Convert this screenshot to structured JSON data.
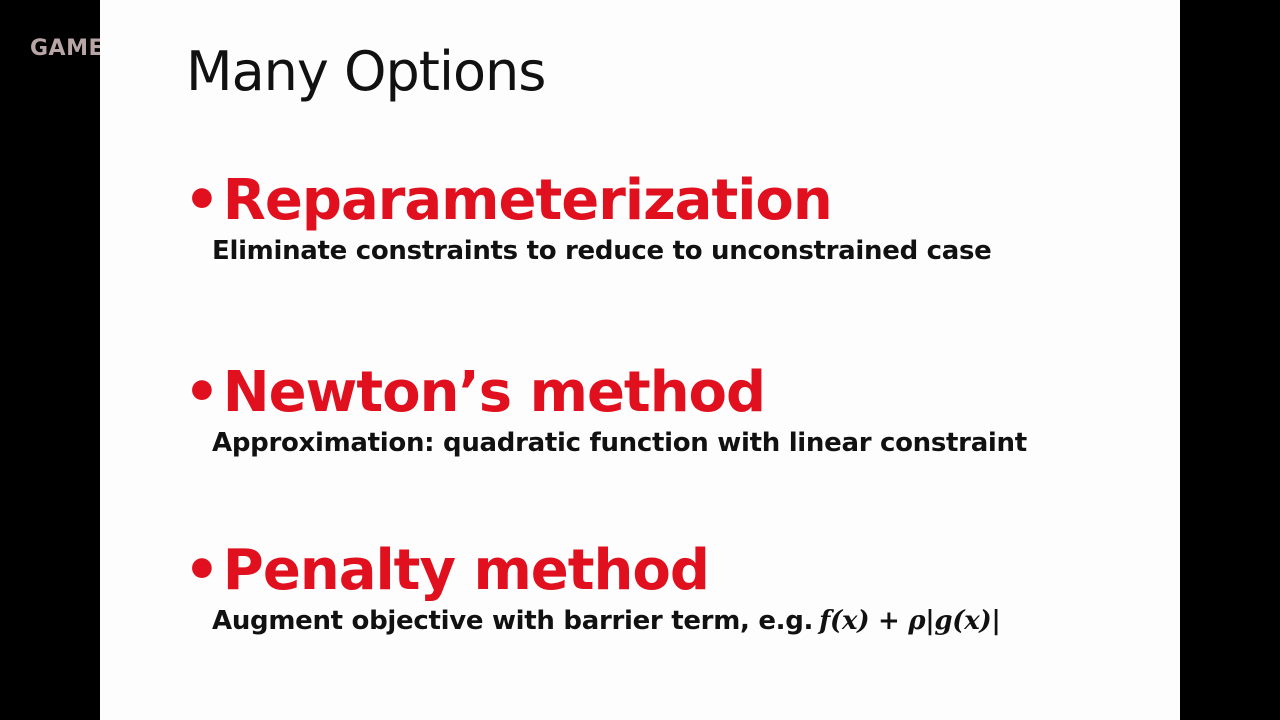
{
  "watermark": "GAME",
  "slide": {
    "title": "Many Options",
    "items": [
      {
        "bullet": "•",
        "heading": "Reparameterization",
        "description": "Eliminate constraints to reduce to unconstrained case"
      },
      {
        "bullet": "•",
        "heading": "Newton’s method",
        "description": "Approximation: quadratic function with linear constraint"
      },
      {
        "bullet": "•",
        "heading": "Penalty method",
        "description": "Augment objective with barrier term, e.g.",
        "formula": "f(x) + ρ|g(x)|"
      }
    ]
  },
  "colors": {
    "heading": "#e0101e",
    "text": "#111111",
    "slide_background": "#fdfdfd",
    "frame_background": "#000000"
  }
}
